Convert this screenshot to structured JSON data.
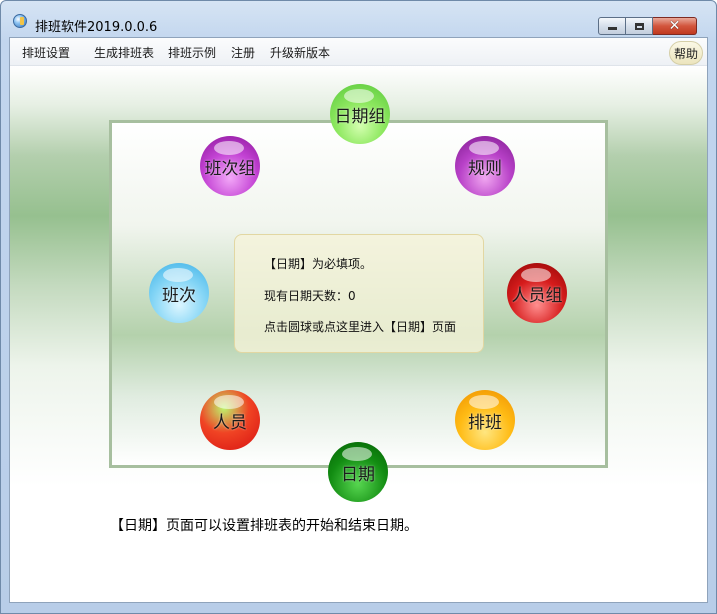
{
  "window": {
    "title": "排班软件2019.0.0.6",
    "close_glyph": "✕"
  },
  "menu": {
    "items": [
      "排班设置",
      "生成排班表",
      "排班示例",
      "注册",
      "升级新版本"
    ],
    "help": "帮助"
  },
  "info": {
    "line1": "【日期】为必填项。",
    "line2": "现有日期天数：0",
    "line3": "点击圆球或点这里进入【日期】页面"
  },
  "balls": {
    "date_group": "日期组",
    "shift_group": "班次组",
    "rules": "规则",
    "shift": "班次",
    "staff_group": "人员组",
    "staff": "人员",
    "schedule": "排班",
    "date": "日期"
  },
  "description": "【日期】页面可以设置排班表的开始和结束日期。",
  "colors": {
    "date_group": "#8ee860",
    "shift_group": "#c343d4",
    "rules": "#b841c8",
    "shift": "#86d6f6",
    "staff_group": "#d61c1c",
    "staff": "#f04424",
    "schedule": "#ffbb14",
    "date": "#128c12"
  }
}
